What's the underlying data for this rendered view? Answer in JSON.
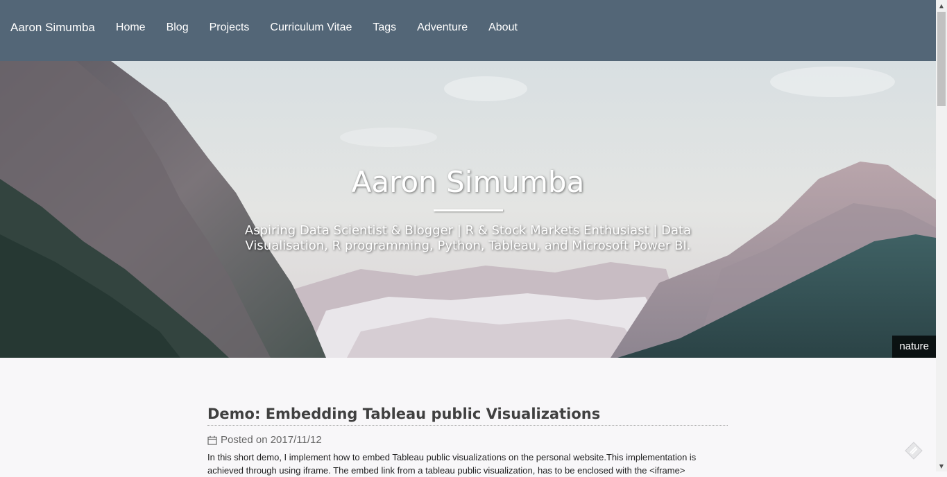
{
  "navbar": {
    "brand": "Aaron Simumba",
    "links": [
      "Home",
      "Blog",
      "Projects",
      "Curriculum Vitae",
      "Tags",
      "Adventure",
      "About"
    ]
  },
  "hero": {
    "title": "Aaron Simumba",
    "subtitle": "Aspiring Data Scientist & Blogger | R & Stock Markets Enthusiast | Data Visualisation, R programming, Python, Tableau, and Microsoft Power BI.",
    "badge": "nature"
  },
  "post": {
    "title": "Demo: Embedding Tableau public Visualizations",
    "meta": "Posted on 2017/11/12",
    "excerpt": "In this short demo, I implement how to embed Tableau public visualizations on the personal website.This implementation is achieved through using iframe. The embed link from a tableau public visualization, has to be enclosed with the <iframe>"
  },
  "icons": {
    "calendar": "calendar-icon",
    "feedback": "feedback-icon"
  },
  "colors": {
    "navbar": "#536677",
    "page_background": "#f8f7f9"
  }
}
